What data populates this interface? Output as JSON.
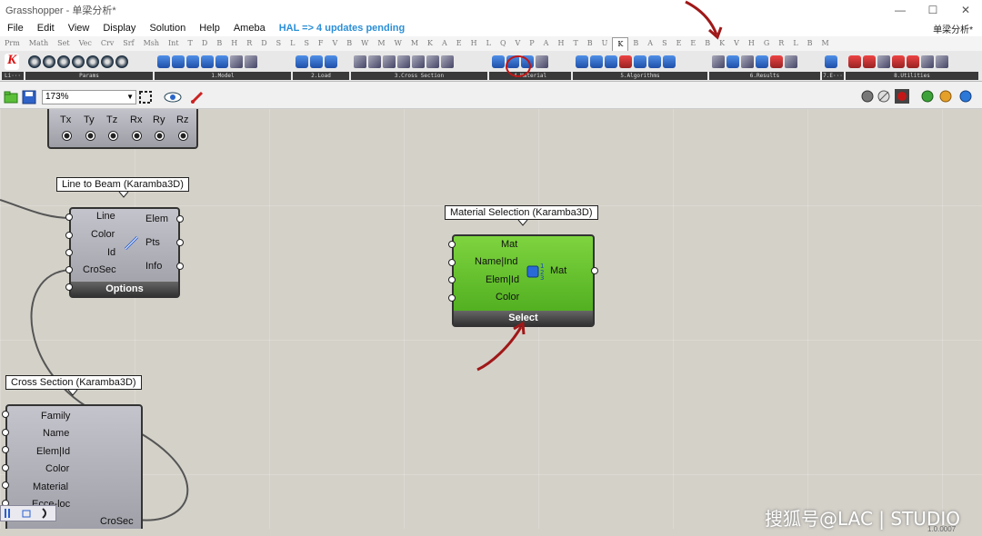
{
  "window": {
    "title": "Grasshopper - 单梁分析*",
    "doc_name": "单梁分析*"
  },
  "menu": {
    "items": [
      "File",
      "Edit",
      "View",
      "Display",
      "Solution",
      "Help",
      "Ameba"
    ],
    "hal_notice": "HAL => 4 updates pending"
  },
  "tabs": [
    "Prm",
    "Math",
    "Set",
    "Vec",
    "Crv",
    "Srf",
    "Msh",
    "Int",
    "T",
    "D",
    "B",
    "H",
    "R",
    "D",
    "S",
    "L",
    "S",
    "F",
    "V",
    "B",
    "W",
    "M",
    "W",
    "M",
    "K",
    "A",
    "E",
    "H",
    "L",
    "Q",
    "V",
    "P",
    "A",
    "H",
    "T",
    "B",
    "U",
    "K",
    "B",
    "A",
    "S",
    "E",
    "E",
    "B",
    "K",
    "V",
    "H",
    "G",
    "R",
    "L",
    "B",
    "M"
  ],
  "active_tab_index": 37,
  "ribbon": {
    "groups": [
      {
        "label": "Li···"
      },
      {
        "label": "Params"
      },
      {
        "label": "1.Model"
      },
      {
        "label": "2.Load"
      },
      {
        "label": "3.Cross Section"
      },
      {
        "label": "4.Material"
      },
      {
        "label": "5.Algorithms"
      },
      {
        "label": "6.Results"
      },
      {
        "label": "7.E···"
      },
      {
        "label": "8.Utilities"
      }
    ]
  },
  "canvas_toolbar": {
    "zoom": "173%"
  },
  "components": {
    "support": {
      "outputs": [
        "Tx",
        "Ty",
        "Tz",
        "Rx",
        "Ry",
        "Rz"
      ]
    },
    "line_to_beam": {
      "title": "Line to Beam (Karamba3D)",
      "inputs": [
        "Line",
        "Color",
        "Id",
        "CroSec"
      ],
      "outputs": [
        "Elem",
        "Pts",
        "Info"
      ],
      "footer": "Options"
    },
    "material_selection": {
      "title": "Material Selection (Karamba3D)",
      "inputs": [
        "Mat",
        "Name|Ind",
        "Elem|Id",
        "Color"
      ],
      "output": "Mat",
      "footer": "Select"
    },
    "cross_section": {
      "title": "Cross Section (Karamba3D)",
      "inputs": [
        "Family",
        "Name",
        "Elem|Id",
        "Color",
        "Material",
        "Ecce-loc"
      ],
      "output": "CroSec"
    }
  },
  "colors": {
    "annotation": "#a01818",
    "component_green": "#5cc02a",
    "canvas": "#d4d1c9"
  },
  "watermark": "搜狐号@LAC | STUDIO",
  "version": "1.0.0007"
}
